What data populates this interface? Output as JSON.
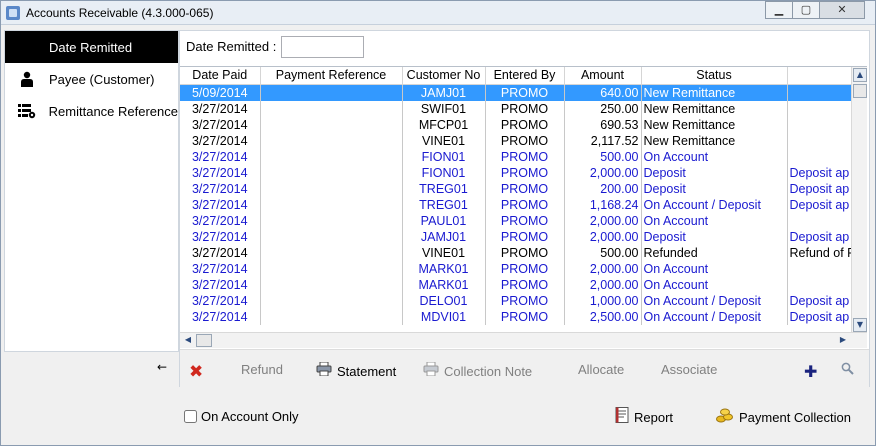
{
  "window": {
    "title": "Accounts Receivable (4.3.000-065)",
    "controls": {
      "minimize": "▁",
      "maximize": "▢",
      "close": "✕"
    }
  },
  "sidebar": {
    "items": [
      {
        "label": "Date Remitted",
        "icon": "",
        "active": true
      },
      {
        "label": "Payee (Customer)",
        "icon": "person-icon",
        "active": false
      },
      {
        "label": "Remittance Reference",
        "icon": "list-settings-icon",
        "active": false
      }
    ],
    "collapse_glyph": "←"
  },
  "filter": {
    "label": "Date Remitted :",
    "value": ""
  },
  "grid": {
    "columns": [
      "Date Paid",
      "Payment Reference",
      "Customer No",
      "Entered By",
      "Amount",
      "Status",
      ""
    ],
    "rows": [
      {
        "date": "5/09/2014",
        "ref": "",
        "cust": "JAMJ01",
        "by": "PROMO",
        "amount": "640.00",
        "status": "New Remittance",
        "notes": "",
        "style": "sel"
      },
      {
        "date": "3/27/2014",
        "ref": "",
        "cust": "SWIF01",
        "by": "PROMO",
        "amount": "250.00",
        "status": "New Remittance",
        "notes": "",
        "style": "black"
      },
      {
        "date": "3/27/2014",
        "ref": "",
        "cust": "MFCP01",
        "by": "PROMO",
        "amount": "690.53",
        "status": "New Remittance",
        "notes": "",
        "style": "black"
      },
      {
        "date": "3/27/2014",
        "ref": "",
        "cust": "VINE01",
        "by": "PROMO",
        "amount": "2,117.52",
        "status": "New Remittance",
        "notes": "",
        "style": "black"
      },
      {
        "date": "3/27/2014",
        "ref": "",
        "cust": "FION01",
        "by": "PROMO",
        "amount": "500.00",
        "status": "On Account",
        "notes": "",
        "style": "blue"
      },
      {
        "date": "3/27/2014",
        "ref": "",
        "cust": "FION01",
        "by": "PROMO",
        "amount": "2,000.00",
        "status": "Deposit",
        "notes": "Deposit ap",
        "style": "blue"
      },
      {
        "date": "3/27/2014",
        "ref": "",
        "cust": "TREG01",
        "by": "PROMO",
        "amount": "200.00",
        "status": "Deposit",
        "notes": "Deposit ap",
        "style": "blue"
      },
      {
        "date": "3/27/2014",
        "ref": "",
        "cust": "TREG01",
        "by": "PROMO",
        "amount": "1,168.24",
        "status": "On Account / Deposit",
        "notes": "Deposit ap",
        "style": "blue"
      },
      {
        "date": "3/27/2014",
        "ref": "",
        "cust": "PAUL01",
        "by": "PROMO",
        "amount": "2,000.00",
        "status": "On Account",
        "notes": "",
        "style": "blue"
      },
      {
        "date": "3/27/2014",
        "ref": "",
        "cust": "JAMJ01",
        "by": "PROMO",
        "amount": "2,000.00",
        "status": "Deposit",
        "notes": "Deposit ap",
        "style": "blue"
      },
      {
        "date": "3/27/2014",
        "ref": "",
        "cust": "VINE01",
        "by": "PROMO",
        "amount": "500.00",
        "status": "Refunded",
        "notes": "Refund of P",
        "style": "black"
      },
      {
        "date": "3/27/2014",
        "ref": "",
        "cust": "MARK01",
        "by": "PROMO",
        "amount": "2,000.00",
        "status": "On Account",
        "notes": "",
        "style": "blue"
      },
      {
        "date": "3/27/2014",
        "ref": "",
        "cust": "MARK01",
        "by": "PROMO",
        "amount": "2,000.00",
        "status": "On Account",
        "notes": "",
        "style": "blue"
      },
      {
        "date": "3/27/2014",
        "ref": "",
        "cust": "DELO01",
        "by": "PROMO",
        "amount": "1,000.00",
        "status": "On Account / Deposit",
        "notes": "Deposit ap",
        "style": "blue"
      },
      {
        "date": "3/27/2014",
        "ref": "",
        "cust": "MDVI01",
        "by": "PROMO",
        "amount": "2,500.00",
        "status": "On Account / Deposit",
        "notes": "Deposit ap",
        "style": "blue"
      }
    ]
  },
  "actions": {
    "refund": "Refund",
    "statement": "Statement",
    "collection_note": "Collection Note",
    "allocate": "Allocate",
    "associate": "Associate"
  },
  "bottom": {
    "on_account_only": "On Account Only",
    "report": "Report",
    "payment_collection": "Payment Collection"
  },
  "colors": {
    "selection": "#3399ff",
    "link_text": "#1a1ad0",
    "active_sidebar": "#000000"
  }
}
